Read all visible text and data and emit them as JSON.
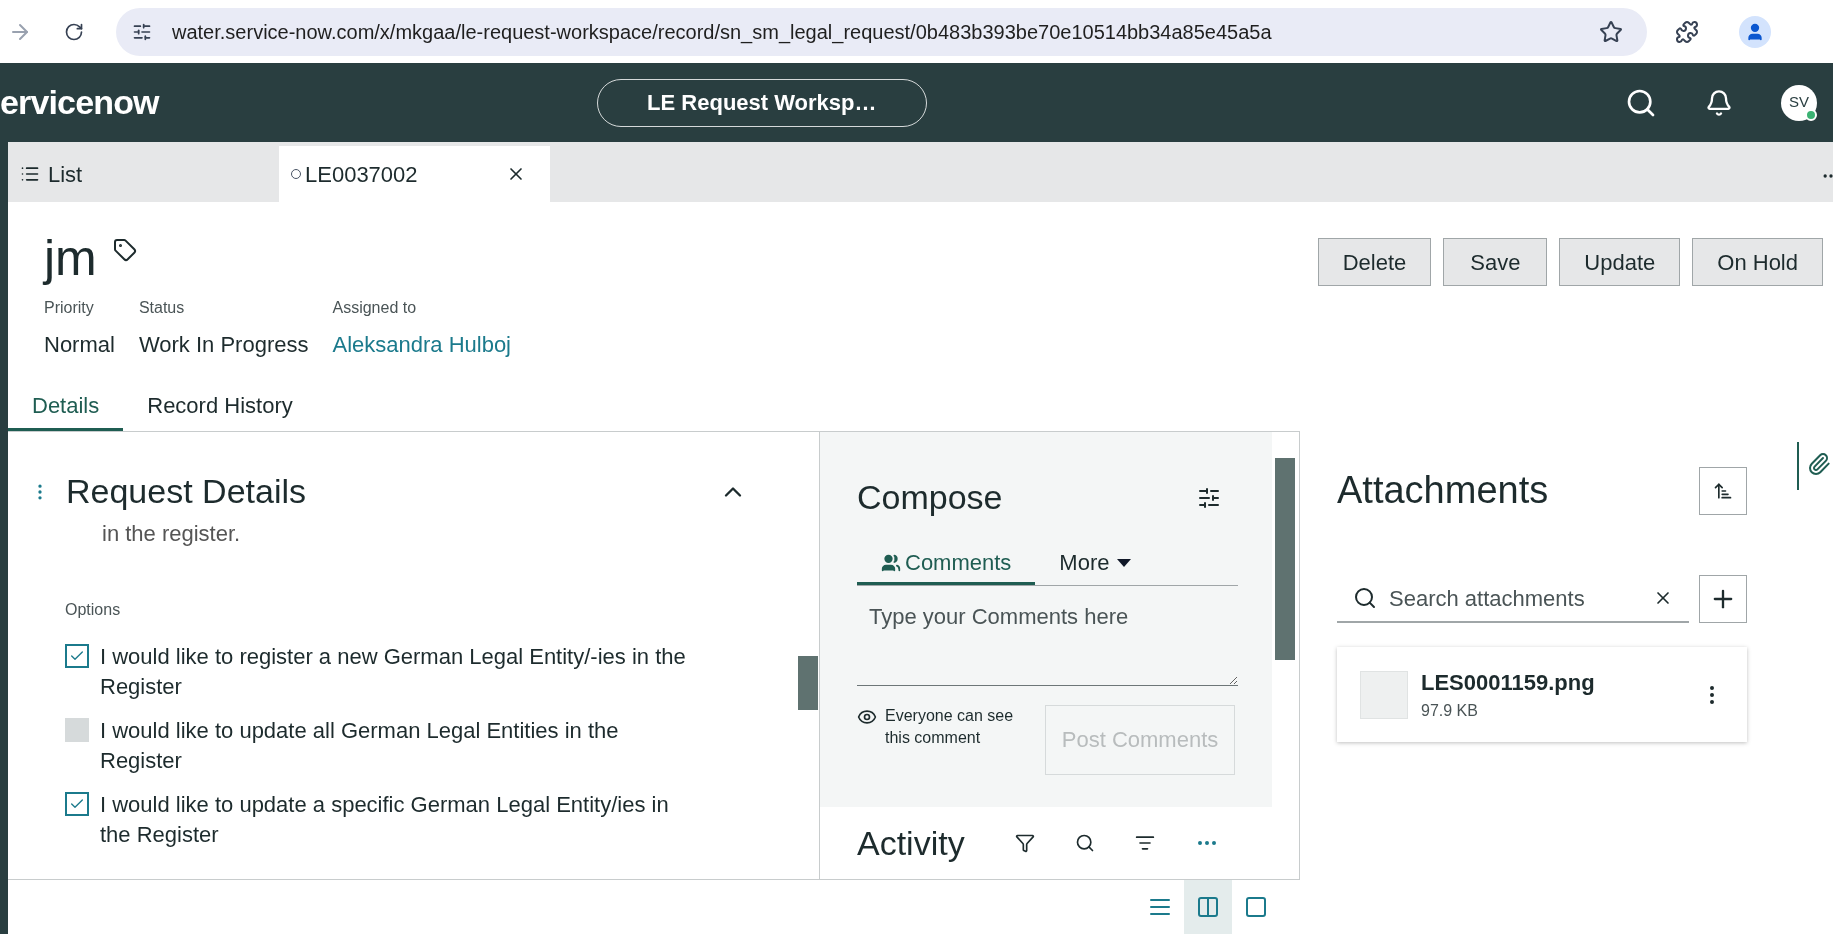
{
  "browser": {
    "url": "water.service-now.com/x/mkgaa/le-request-workspace/record/sn_sm_legal_request/0b483b393be70e10514bb34a85e45a5a"
  },
  "header": {
    "logo": "ervicenow",
    "workspace": "LE Request Worksp…",
    "avatar": "SV"
  },
  "record_tabs": [
    {
      "label": "List",
      "selected": false
    },
    {
      "label": "LE0037002",
      "selected": true
    }
  ],
  "record": {
    "title": "jm",
    "fields": [
      {
        "label": "Priority",
        "value": "Normal",
        "kind": "text"
      },
      {
        "label": "Status",
        "value": "Work In Progress",
        "kind": "text"
      },
      {
        "label": "Assigned to",
        "value": "Aleksandra Hulboj",
        "kind": "link"
      }
    ],
    "actions": [
      "Delete",
      "Save",
      "Update",
      "On Hold"
    ]
  },
  "detail_tabs": [
    {
      "label": "Details",
      "selected": true
    },
    {
      "label": "Record History",
      "selected": false
    }
  ],
  "request_details": {
    "title": "Request Details",
    "expanded": true,
    "text_tail": "in the register.",
    "options_label": "Options",
    "options": [
      {
        "label": "I would like to register a new German Legal Entity/-ies in the Register",
        "checked": true,
        "disabled": false
      },
      {
        "label": "I would like to update all German Legal Entities in the Register",
        "checked": false,
        "disabled": true
      },
      {
        "label": "I would like to update a specific German Legal Entity/ies in the Register",
        "checked": true,
        "disabled": false
      }
    ]
  },
  "compose": {
    "title": "Compose",
    "tabs": [
      {
        "label": "Comments",
        "selected": true,
        "kind": "tab"
      },
      {
        "label": "More",
        "selected": false,
        "kind": "menu"
      }
    ],
    "placeholder": "Type your Comments here",
    "visibility": "Everyone can see this comment",
    "post_button": "Post Comments",
    "post_disabled": true
  },
  "activity": {
    "title": "Activity"
  },
  "attachments": {
    "title": "Attachments",
    "search_placeholder": "Search attachments",
    "files": [
      {
        "name": "LES0001159.png",
        "size": "97.9 KB"
      }
    ]
  },
  "view_buttons": [
    {
      "selected": false
    },
    {
      "selected": true
    },
    {
      "selected": false
    }
  ]
}
